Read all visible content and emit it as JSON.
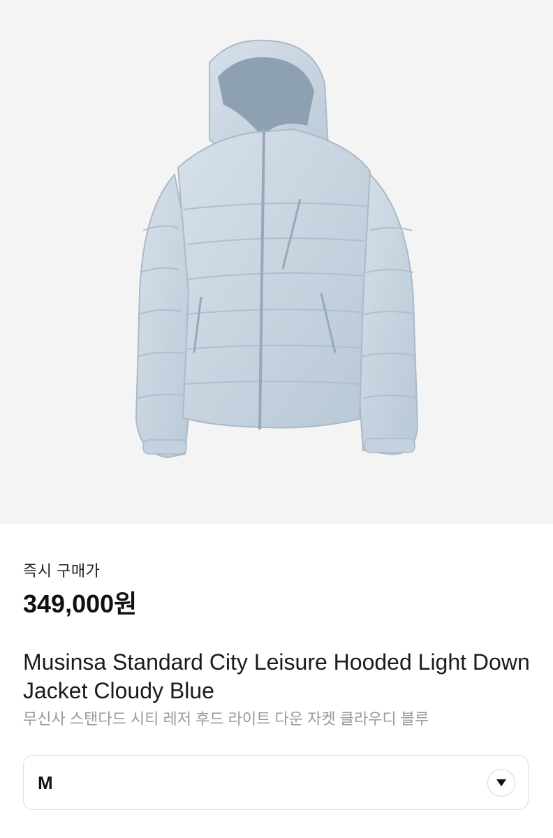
{
  "product": {
    "image_alt": "Cloudy blue hooded light down jacket",
    "price_label": "즉시 구매가",
    "price": "349,000원",
    "title": "Musinsa Standard City Leisure Hooded Light Down Jacket Cloudy Blue",
    "subtitle": "무신사 스탠다드 시티 레저 후드 라이트 다운 자켓 클라우디 블루"
  },
  "size_selector": {
    "selected": "M",
    "icon": "chevron-down-icon"
  },
  "colors": {
    "hero_bg": "#f4f4f4",
    "jacket": "#c9d6e2",
    "jacket_shadow": "#a9bac9",
    "hood_inner": "#8ea1b3"
  }
}
